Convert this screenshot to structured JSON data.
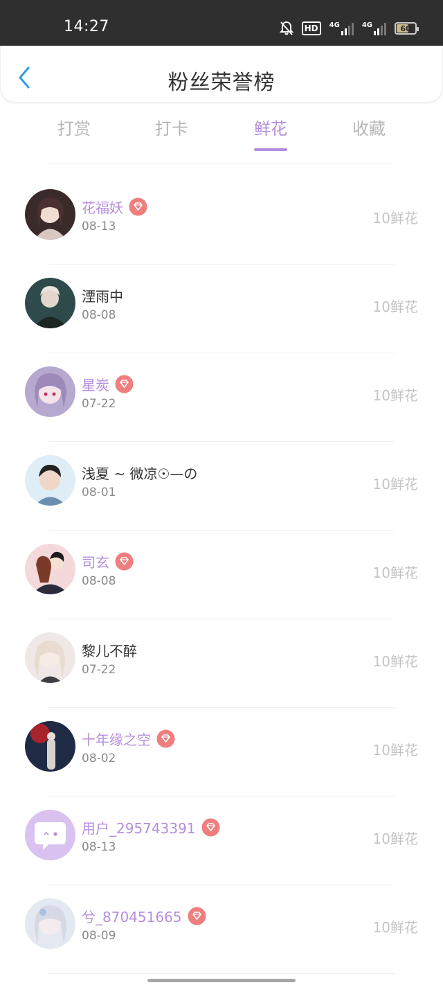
{
  "status_bar": {
    "time": "14:27",
    "hd_label": "HD",
    "network_1": "4G",
    "network_2": "4G",
    "battery": "60"
  },
  "header": {
    "title": "粉丝荣誉榜"
  },
  "tabs": [
    {
      "label": "打赏"
    },
    {
      "label": "打卡"
    },
    {
      "label": "鲜花"
    },
    {
      "label": "收藏"
    }
  ],
  "active_tab": "鲜花",
  "colors": {
    "accent": "#b58ede",
    "badge": "#ef7e7e",
    "back_arrow": "#2f9ae9"
  },
  "fans": [
    {
      "name": "花福妖",
      "date": "08-13",
      "amount": "10鲜花",
      "vip": true
    },
    {
      "name": "湮雨中",
      "date": "08-08",
      "amount": "10鲜花",
      "vip": false
    },
    {
      "name": "星炭",
      "date": "07-22",
      "amount": "10鲜花",
      "vip": true
    },
    {
      "name": "浅夏 ~ 微凉☉—の",
      "date": "08-01",
      "amount": "10鲜花",
      "vip": false
    },
    {
      "name": "司玄",
      "date": "08-08",
      "amount": "10鲜花",
      "vip": true
    },
    {
      "name": "黎儿不醉",
      "date": "07-22",
      "amount": "10鲜花",
      "vip": false
    },
    {
      "name": "十年缘之空",
      "date": "08-02",
      "amount": "10鲜花",
      "vip": true
    },
    {
      "name": "用户_295743391",
      "date": "08-13",
      "amount": "10鲜花",
      "vip": true
    },
    {
      "name": "兮_870451665",
      "date": "08-09",
      "amount": "10鲜花",
      "vip": true
    }
  ]
}
